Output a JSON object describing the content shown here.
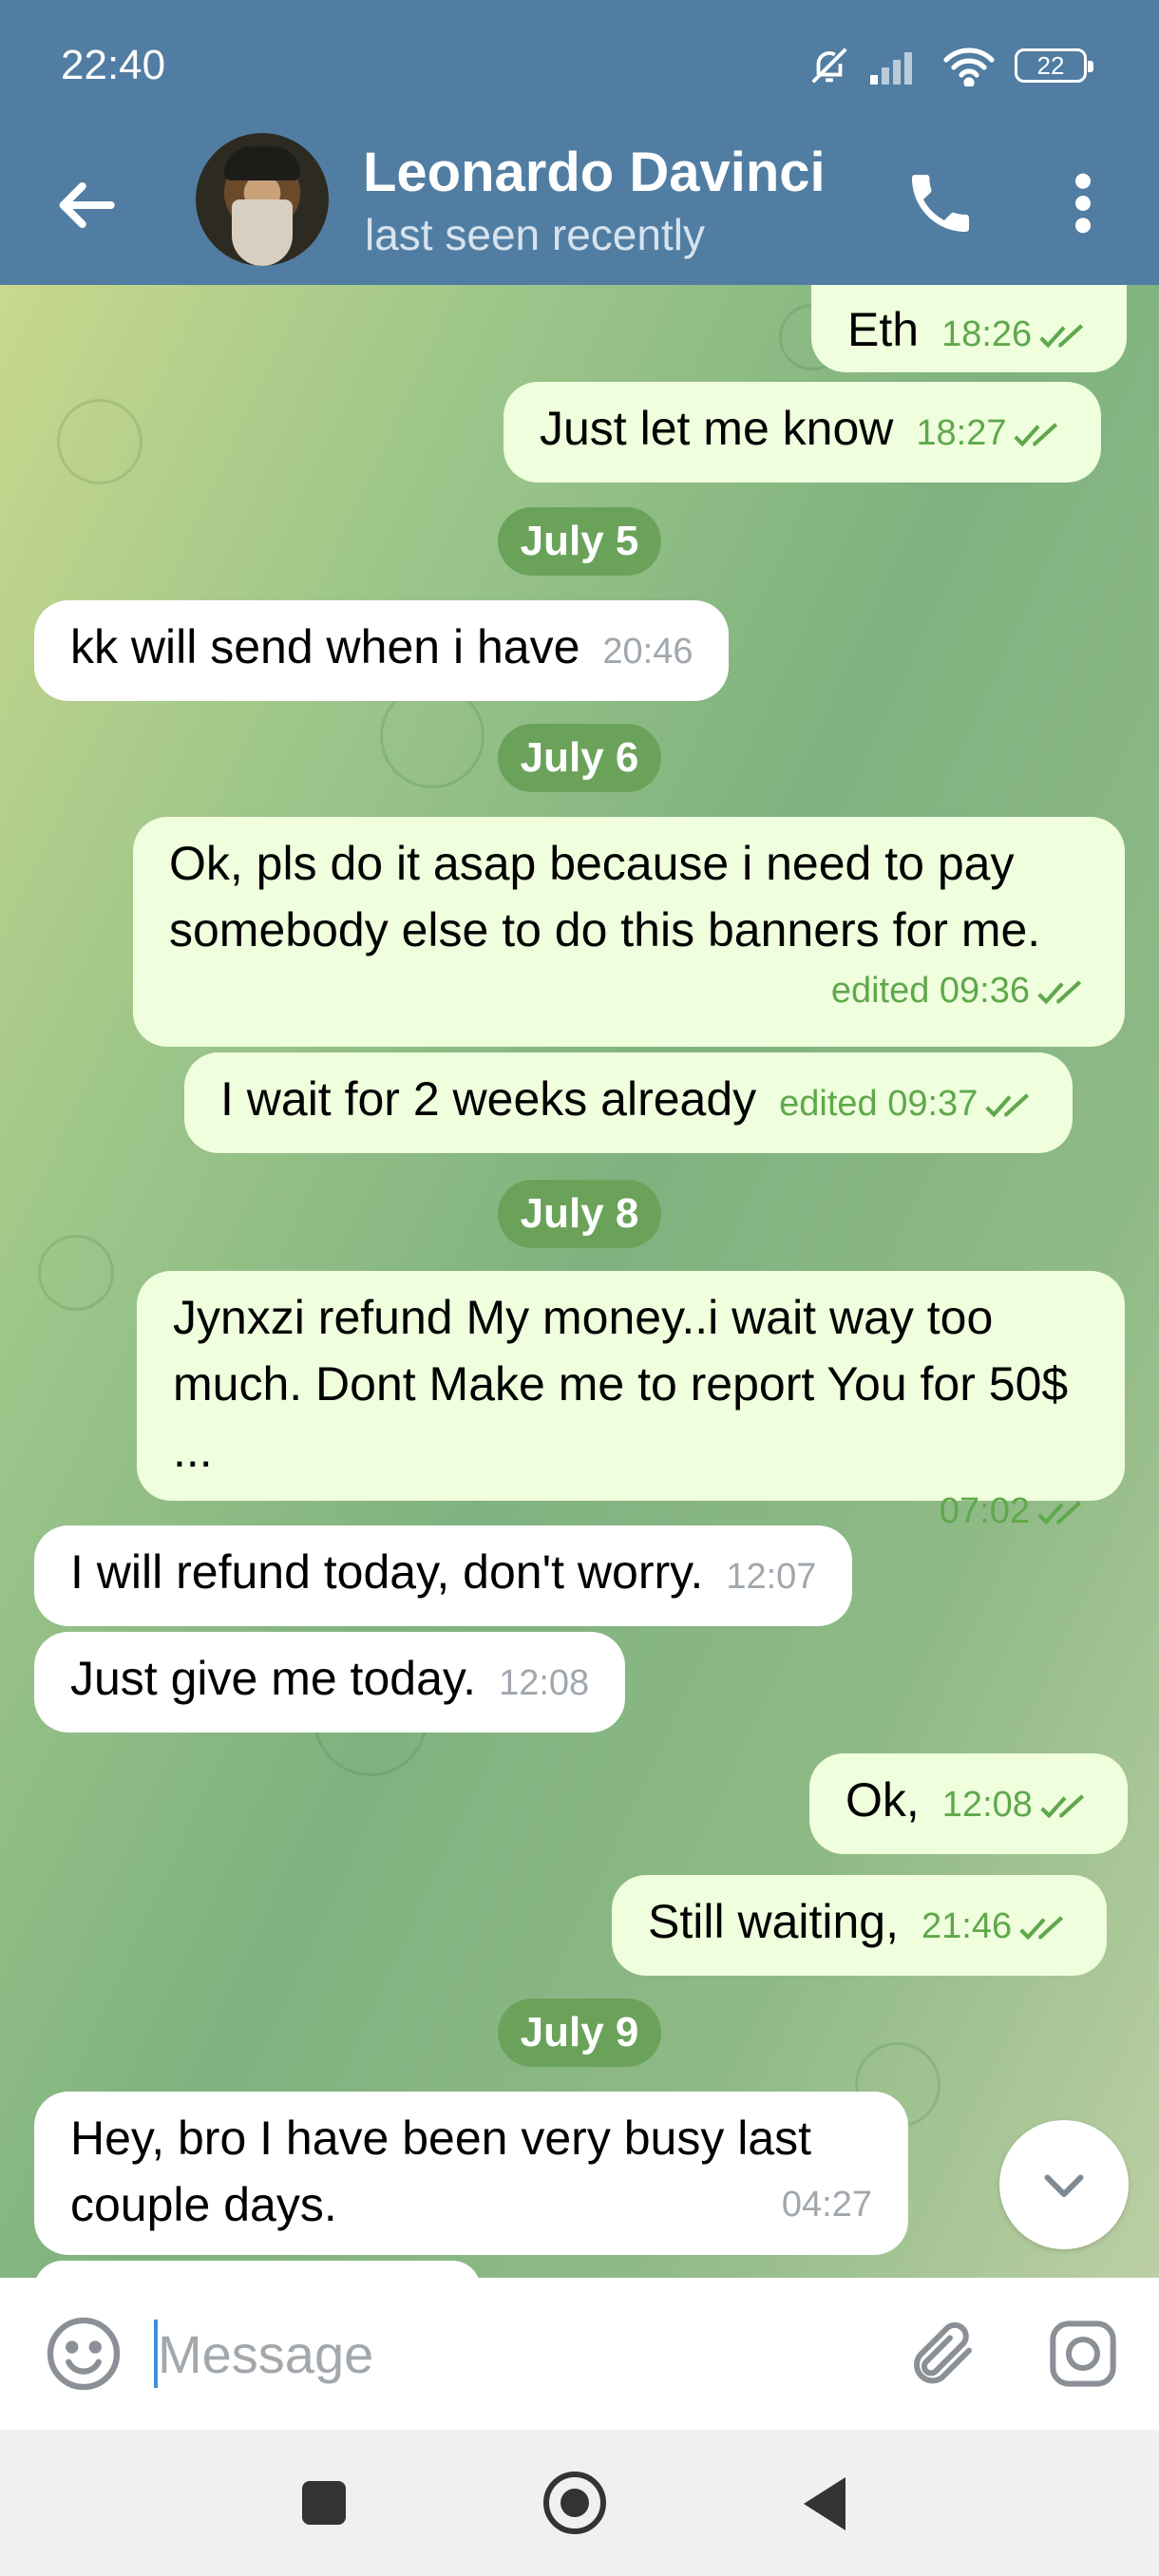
{
  "status_bar": {
    "time": "22:40",
    "battery": "22"
  },
  "header": {
    "contact_name": "Leonardo Davinci",
    "contact_status": "last seen recently"
  },
  "icons": {
    "back": "arrow-left-icon",
    "call": "phone-icon",
    "more": "more-vertical-icon",
    "emoji": "emoji-icon",
    "attach": "paperclip-icon",
    "camera": "camera-icon",
    "scroll_down": "chevron-down-icon",
    "read": "double-check-icon"
  },
  "colors": {
    "header": "#517da2",
    "outgoing_bubble": "#effedd",
    "incoming_bubble": "#ffffff",
    "date_pill": "#6aa25a",
    "accent_time": "#5fa84c"
  },
  "dates": [
    "July 5",
    "July 6",
    "July 8",
    "July 9"
  ],
  "messages": [
    {
      "dir": "out",
      "text": "Eth",
      "time": "18:26"
    },
    {
      "dir": "out",
      "text": "Just let me know",
      "time": "18:27"
    },
    {
      "dir": "in",
      "text": "kk will send when i have",
      "time": "20:46"
    },
    {
      "dir": "out",
      "text": "Ok, pls do it asap because i need to pay somebody else to do this banners for me.",
      "time": "edited 09:36"
    },
    {
      "dir": "out",
      "text": "I wait for 2 weeks already",
      "time": "edited 09:37"
    },
    {
      "dir": "out",
      "text": "Jynxzi  refund My money..i wait way too much. Dont Make me to report You for 50$ ...",
      "time": "07:02"
    },
    {
      "dir": "in",
      "text": "I will refund today, don't worry.",
      "time": "12:07"
    },
    {
      "dir": "in",
      "text": "Just give me today.",
      "time": "12:08"
    },
    {
      "dir": "out",
      "text": "Ok,",
      "time": "12:08"
    },
    {
      "dir": "out",
      "text": "Still waiting,",
      "time": "21:46"
    },
    {
      "dir": "in",
      "text": "Hey, bro I have been very busy last couple days.",
      "time": "04:27"
    }
  ],
  "composer": {
    "placeholder": "Message"
  }
}
